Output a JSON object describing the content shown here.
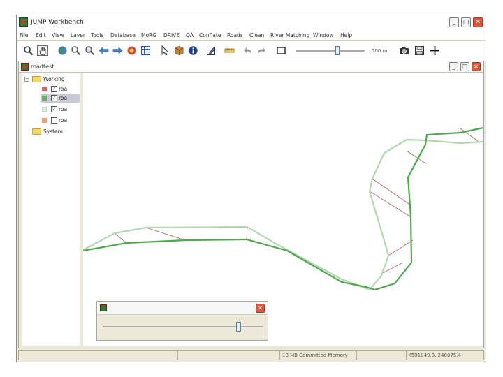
{
  "window": {
    "title": "JUMP Workbench"
  },
  "menu": [
    "File",
    "Edit",
    "View",
    "Layer",
    "Tools",
    "Database",
    "MoRG",
    "DRIVE",
    "QA",
    "Conflate",
    "Roads",
    "Clean",
    "River Matching",
    "Window",
    "Help"
  ],
  "toolbar": {
    "icons": [
      "zoom-icon",
      "pan-hand-icon",
      "globe-icon",
      "zoom-to-selection-icon",
      "zoom-previous-icon",
      "back-arrow-icon",
      "forward-arrow-icon",
      "refresh-icon",
      "grid-icon",
      "select-pointer-icon",
      "feature-box-icon",
      "info-icon",
      "edit-icon",
      "measure-icon",
      "undo-icon",
      "redo-icon",
      "square-icon",
      "camera-icon",
      "save-icon",
      "plus-icon"
    ],
    "scale_label": "500 m",
    "zoom_level": 0.58
  },
  "task_frame": {
    "title": "roadtest"
  },
  "layer_tree": {
    "categories": [
      {
        "name": "Working",
        "expander": "−",
        "layers": [
          {
            "label": "roa",
            "checked": true,
            "color": "#c96a6a"
          },
          {
            "label": "roa",
            "checked": true,
            "color": "#62b362",
            "selected": true
          },
          {
            "label": "roa",
            "checked": true,
            "color": "#d9efd9"
          },
          {
            "label": "roa",
            "checked": false,
            "color": "#f0a070"
          }
        ]
      },
      {
        "name": "System",
        "layers": []
      }
    ]
  },
  "palette": {
    "slider_value": 0.87
  },
  "status": {
    "cells": [
      "",
      "",
      "10 MB Committed Memory",
      "",
      "(501049.0, 240075.4)"
    ]
  },
  "colors": {
    "road_primary": "#4fa84f",
    "road_secondary": "#b4d6b4",
    "match_link": "#b06060"
  }
}
